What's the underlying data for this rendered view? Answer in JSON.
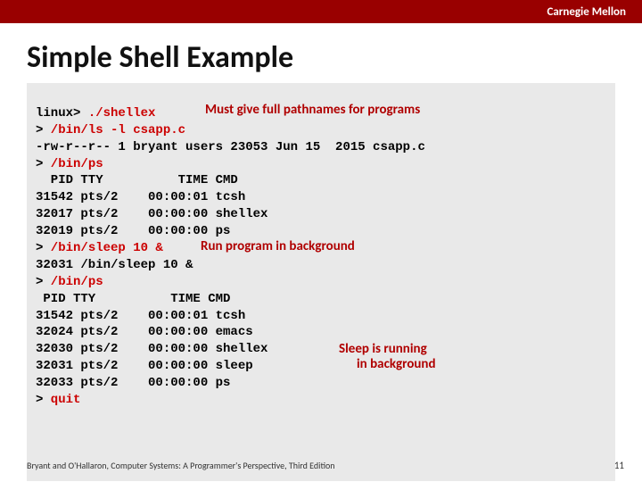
{
  "header": {
    "brand": "Carnegie Mellon"
  },
  "title": "Simple Shell Example",
  "notes": {
    "fullpath": "Must give full pathnames for programs",
    "bg": "Run program in background",
    "sleep1": "Sleep is running",
    "sleep2": "in background"
  },
  "term": {
    "l1_prompt": "linux>",
    "l1_cmd": " ./shellex",
    "l2_prompt": ">",
    "l2_cmd": " /bin/ls -l csapp.c",
    "l3": "-rw-r--r-- 1 bryant users 23053 Jun 15  2015 csapp.c",
    "l4_prompt": ">",
    "l4_cmd": " /bin/ps",
    "l5": "  PID TTY          TIME CMD",
    "l6": "31542 pts/2    00:00:01 tcsh",
    "l7": "32017 pts/2    00:00:00 shellex",
    "l8": "32019 pts/2    00:00:00 ps",
    "l9_prompt": ">",
    "l9_cmd": " /bin/sleep 10 &",
    "l10": "32031 /bin/sleep 10 &",
    "l11_prompt": ">",
    "l11_cmd": " /bin/ps",
    "l12": " PID TTY          TIME CMD",
    "l13": "31542 pts/2    00:00:01 tcsh",
    "l14": "32024 pts/2    00:00:00 emacs",
    "l15": "32030 pts/2    00:00:00 shellex",
    "l16": "32031 pts/2    00:00:00 sleep",
    "l17": "32033 pts/2    00:00:00 ps",
    "l18_prompt": ">",
    "l18_cmd": " quit"
  },
  "footer": "Bryant and O'Hallaron, Computer Systems: A Programmer's Perspective, Third Edition",
  "page": "11"
}
